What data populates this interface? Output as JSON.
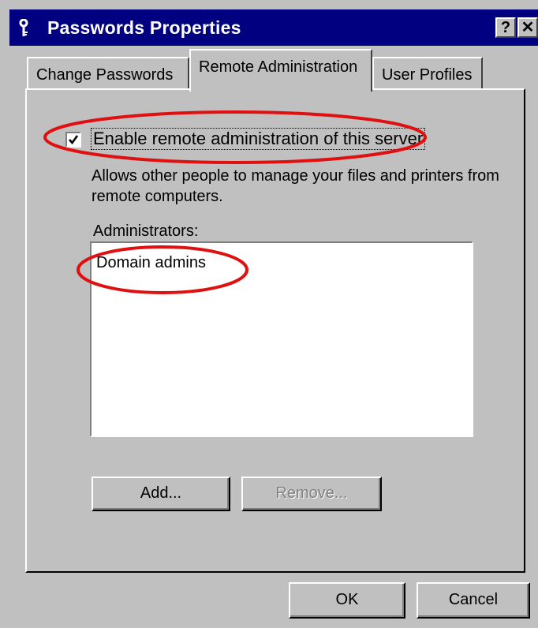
{
  "window": {
    "title": "Passwords Properties",
    "icon": "key-icon",
    "help_label": "?",
    "close_label": "✕"
  },
  "tabs": [
    {
      "label": "Change Passwords",
      "selected": false
    },
    {
      "label": "Remote Administration",
      "selected": true
    },
    {
      "label": "User Profiles",
      "selected": false
    }
  ],
  "remote": {
    "checkbox_checked": true,
    "checkbox_label": "Enable remote administration of this server",
    "description": "Allows other people to manage your files and printers from remote computers.",
    "administrators_label": "Administrators:",
    "administrators": [
      "Domain admins"
    ],
    "add_label": "Add...",
    "remove_label": "Remove...",
    "remove_disabled": true
  },
  "footer": {
    "ok_label": "OK",
    "cancel_label": "Cancel"
  },
  "annotation_color": "#e01010"
}
